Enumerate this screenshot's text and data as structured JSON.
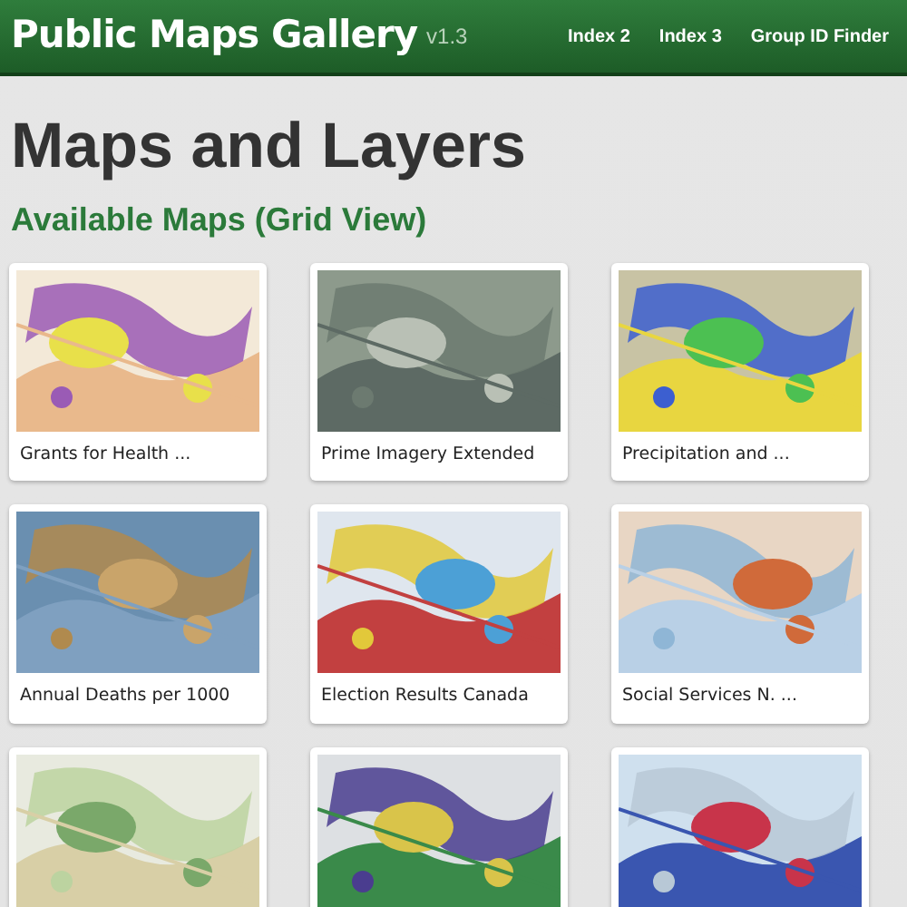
{
  "header": {
    "title": "Public Maps Gallery",
    "version": "v1.3",
    "nav": [
      {
        "label": "Index 2"
      },
      {
        "label": "Index 3"
      },
      {
        "label": "Group ID Finder"
      }
    ]
  },
  "heading": "Maps and Layers",
  "subheading": "Available Maps (Grid View)",
  "cards": [
    {
      "kind": "picture",
      "title": "Grants for Health ..."
    },
    {
      "kind": "picture",
      "title": "Prime Imagery Extended"
    },
    {
      "kind": "picture",
      "title": "Precipitation and ..."
    },
    {
      "kind": "picture",
      "title": "Annual Deaths per 1000"
    },
    {
      "kind": "picture",
      "title": "Election Results Canada"
    },
    {
      "kind": "picture",
      "title": "Social Services N. ..."
    },
    {
      "kind": "picture"
    },
    {
      "kind": "picture"
    },
    {
      "kind": "picture"
    }
  ]
}
